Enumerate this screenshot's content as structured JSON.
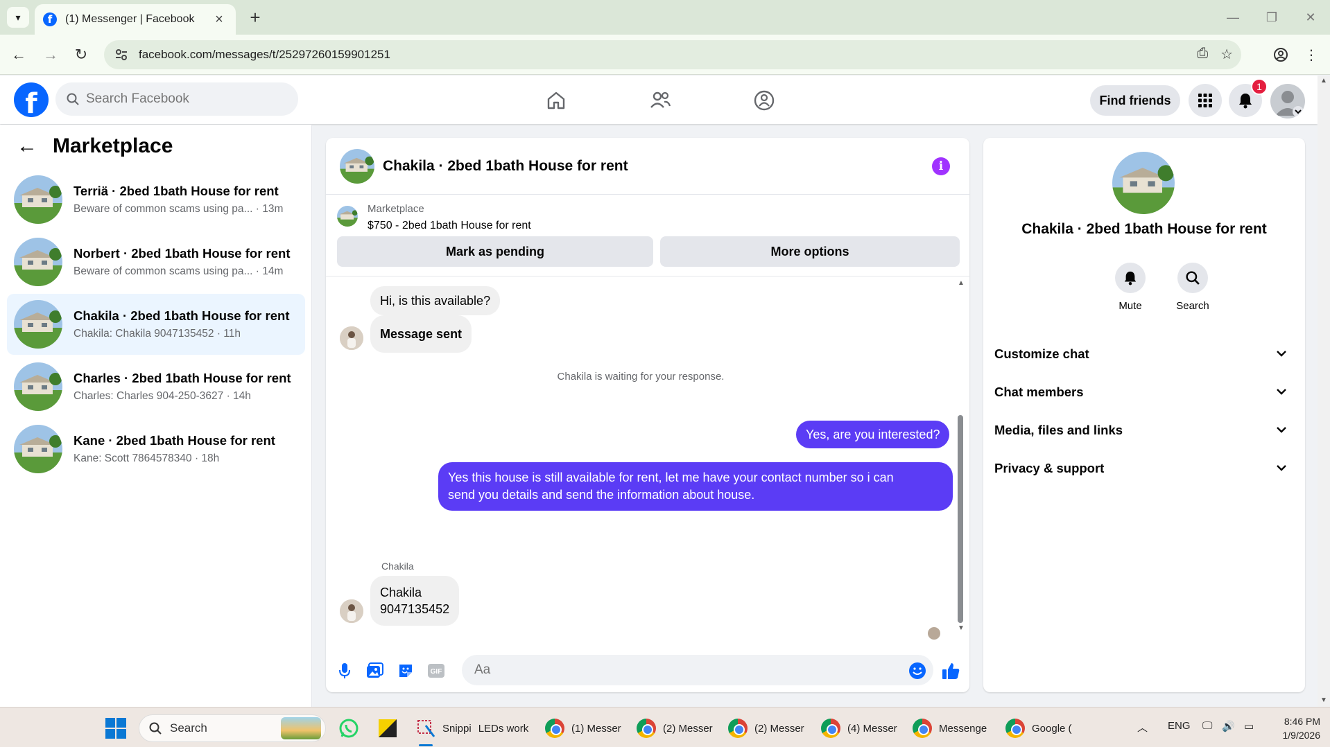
{
  "browser": {
    "tab_title": "(1) Messenger | Facebook",
    "url": "facebook.com/messages/t/25297260159901251"
  },
  "fb_header": {
    "search_placeholder": "Search Facebook",
    "find_friends_label": "Find friends",
    "notification_count": "1"
  },
  "left_panel": {
    "title": "Marketplace",
    "conversations": [
      {
        "title": "Terriä · 2bed 1bath House for rent",
        "subtitle": "Beware of common scams using pa... · 13m",
        "active": false
      },
      {
        "title": "Norbert · 2bed 1bath House for rent",
        "subtitle": "Beware of common scams using pa... · 14m",
        "active": false
      },
      {
        "title": "Chakila · 2bed 1bath House for rent",
        "subtitle": "Chakila: Chakila 9047135452 · 11h",
        "active": true
      },
      {
        "title": "Charles · 2bed 1bath House for rent",
        "subtitle": "Charles: Charles 904-250-3627 · 14h",
        "active": false
      },
      {
        "title": "Kane · 2bed 1bath House for rent",
        "subtitle": "Kane: Scott 7864578340 · 18h",
        "active": false
      }
    ]
  },
  "chat": {
    "title": "Chakila · 2bed 1bath House for rent",
    "marketplace_label": "Marketplace",
    "listing": "$750 - 2bed 1bath House for rent",
    "mark_pending_label": "Mark as pending",
    "more_options_label": "More options",
    "messages": {
      "m1": "Hi, is this available?",
      "m2": "Message sent",
      "system": "Chakila is waiting for your response.",
      "m3": "Yes, are you interested?",
      "m4_line1": "Yes this house is still available for rent, let me have your contact number so i can",
      "m4_line2": "send you details and send the information about house.",
      "sender": "Chakila",
      "m5_line1": "Chakila",
      "m5_line2": "9047135452"
    },
    "composer_placeholder": "Aa"
  },
  "right_panel": {
    "title": "Chakila · 2bed 1bath House for rent",
    "mute_label": "Mute",
    "search_label": "Search",
    "sections": [
      "Customize chat",
      "Chat members",
      "Media, files and links",
      "Privacy & support"
    ]
  },
  "taskbar": {
    "search_label": "Search",
    "apps": {
      "snipping": "Snippi",
      "leds": "LEDs work",
      "messenger1": "(1) Messer",
      "messenger2": "(2) Messer",
      "messenger3": "(2) Messer",
      "messenger4": "(4) Messer",
      "messenger5": "Messenge",
      "google": "Google ("
    },
    "language": "ENG",
    "time": "8:46 PM",
    "date": "1/9/2026"
  },
  "colors": {
    "facebook_blue": "#0866ff",
    "outgoing_bubble": "#5b3cf5",
    "info_purple": "#a033ff",
    "notification_red": "#e41e3f"
  }
}
